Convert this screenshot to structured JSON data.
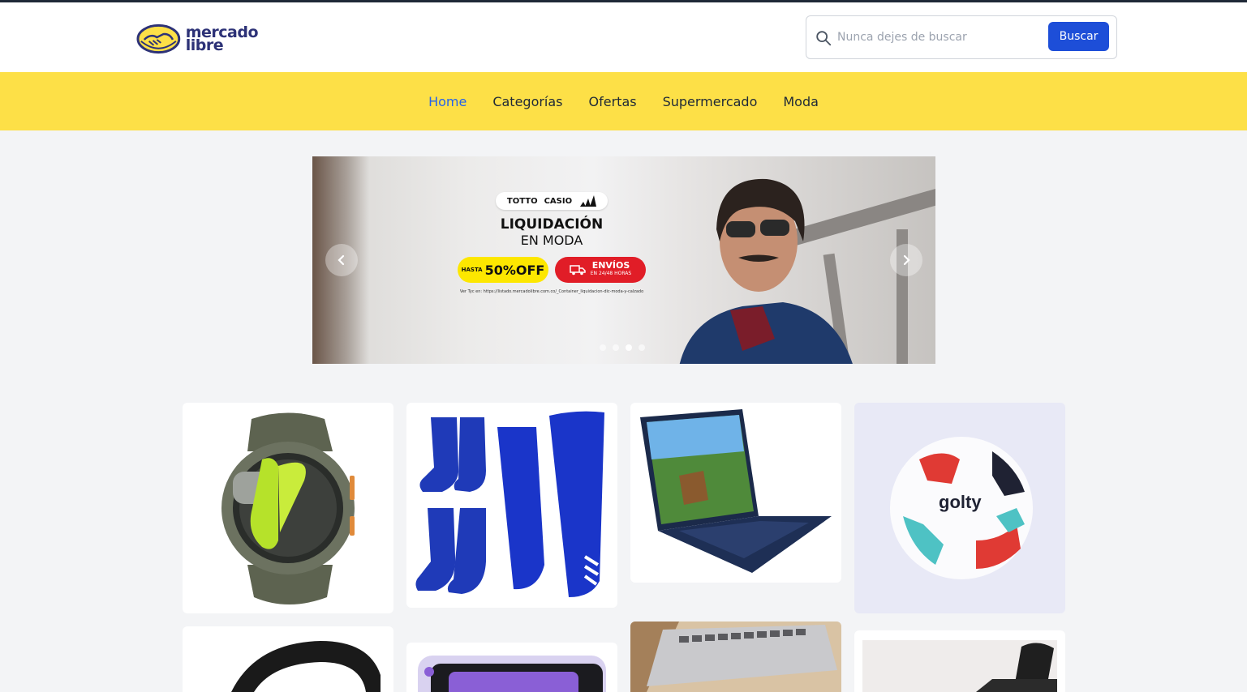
{
  "header": {
    "logo": {
      "line1": "mercado",
      "line2": "libre"
    },
    "search": {
      "placeholder": "Nunca dejes de buscar",
      "value": "",
      "button_label": "Buscar",
      "icon": "search-icon"
    }
  },
  "nav": {
    "items": [
      {
        "label": "Home",
        "active": true
      },
      {
        "label": "Categorías",
        "active": false
      },
      {
        "label": "Ofertas",
        "active": false
      },
      {
        "label": "Supermercado",
        "active": false
      },
      {
        "label": "Moda",
        "active": false
      }
    ]
  },
  "banner": {
    "brands": [
      "TOTTO",
      "CASIO",
      "adidas"
    ],
    "title": "LIQUIDACIÓN",
    "subtitle": "EN MODA",
    "discount_prefix": "HASTA",
    "discount": "50%OFF",
    "shipping_title": "ENVÍOS",
    "shipping_sub": "EN 24/48 HORAS",
    "tyc": "Ver Tyc en: https://listado.mercadolibre.com.co/_Container_liquidacion-dic-moda-y-calzado",
    "slides": 4,
    "active_slide": 2
  },
  "products": [
    {
      "name": "smartwatch"
    },
    {
      "name": "soccer-socks-and-leg-sleeves"
    },
    {
      "name": "laptop"
    },
    {
      "name": "soccer-ball"
    },
    {
      "name": "fitness-band"
    },
    {
      "name": "tablet"
    },
    {
      "name": "laptop-keyboard"
    },
    {
      "name": "strap-product"
    }
  ],
  "colors": {
    "brand_yellow": "#fde047",
    "accent_blue": "#1d4ed8",
    "active_link": "#2563eb",
    "logo_navy": "#2d3277"
  }
}
